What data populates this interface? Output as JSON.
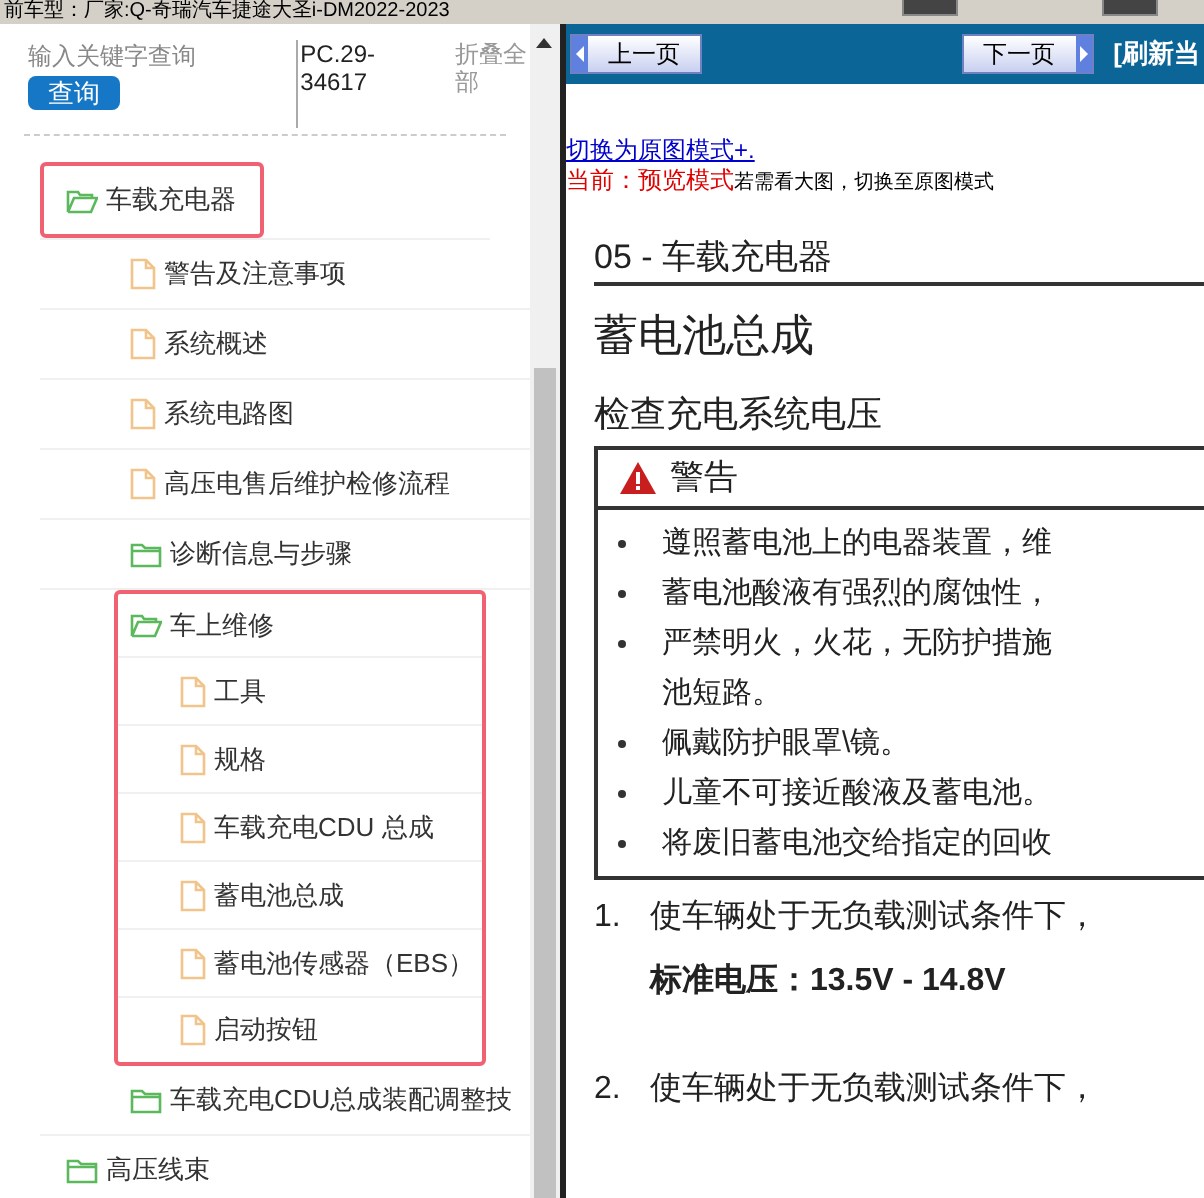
{
  "top_bar": {
    "vehicle": "前车型：厂家:Q-奇瑞汽车捷途大圣i-DM2022-2023"
  },
  "search": {
    "placeholder": "输入关键字查询",
    "button": "查询",
    "code": "PC.29-34617",
    "collapse": "折叠全部"
  },
  "tree": [
    {
      "label": "车载充电器",
      "kind": "folder",
      "expanded": true,
      "highlighted": true,
      "highlight_children": false,
      "children": [
        {
          "label": "警告及注意事项",
          "kind": "doc"
        },
        {
          "label": "系统概述",
          "kind": "doc"
        },
        {
          "label": "系统电路图",
          "kind": "doc"
        },
        {
          "label": "高压电售后维护检修流程",
          "kind": "doc"
        },
        {
          "label": "诊断信息与步骤",
          "kind": "folder",
          "expanded": false
        },
        {
          "label": "车上维修",
          "kind": "folder",
          "expanded": true,
          "highlighted": true,
          "highlight_children": true,
          "children": [
            {
              "label": "工具",
              "kind": "doc"
            },
            {
              "label": "规格",
              "kind": "doc"
            },
            {
              "label": "车载充电CDU 总成",
              "kind": "doc"
            },
            {
              "label": "蓄电池总成",
              "kind": "doc"
            },
            {
              "label": "蓄电池传感器（EBS）",
              "kind": "doc"
            },
            {
              "label": "启动按钮",
              "kind": "doc"
            }
          ]
        },
        {
          "label": "车载充电CDU总成装配调整技",
          "kind": "folder",
          "expanded": false
        }
      ]
    },
    {
      "label": "高压线束",
      "kind": "folder",
      "expanded": false
    }
  ],
  "nav": {
    "prev": "上一页",
    "next": "下一页",
    "refresh": "[刷新当"
  },
  "mode": {
    "switch_link": "切换为原图模式+.",
    "current_label": "当前：预览模式",
    "hint": "若需看大图，切换至原图模式"
  },
  "document": {
    "chapter": "05 - 车载充电器",
    "title": "蓄电池总成",
    "section": "检查充电系统电压",
    "warning_title": "警告",
    "warnings": [
      {
        "text": "遵照蓄电池上的电器装置，维",
        "bullet": true
      },
      {
        "text": "蓄电池酸液有强烈的腐蚀性，",
        "bullet": true
      },
      {
        "text": "严禁明火，火花，无防护措施",
        "bullet": true
      },
      {
        "text": "池短路。",
        "bullet": false
      },
      {
        "text": "佩戴防护眼罩\\镜。",
        "bullet": true
      },
      {
        "text": "儿童不可接近酸液及蓄电池。",
        "bullet": true
      },
      {
        "text": "将废旧蓄电池交给指定的回收",
        "bullet": true
      }
    ],
    "steps": [
      {
        "number": "1.",
        "text": "使车辆处于无负载测试条件下，",
        "spec": "标准电压：**13.5V - 14.8V**"
      },
      {
        "number": "2.",
        "text": "使车辆处于无负载测试条件下，"
      }
    ]
  }
}
